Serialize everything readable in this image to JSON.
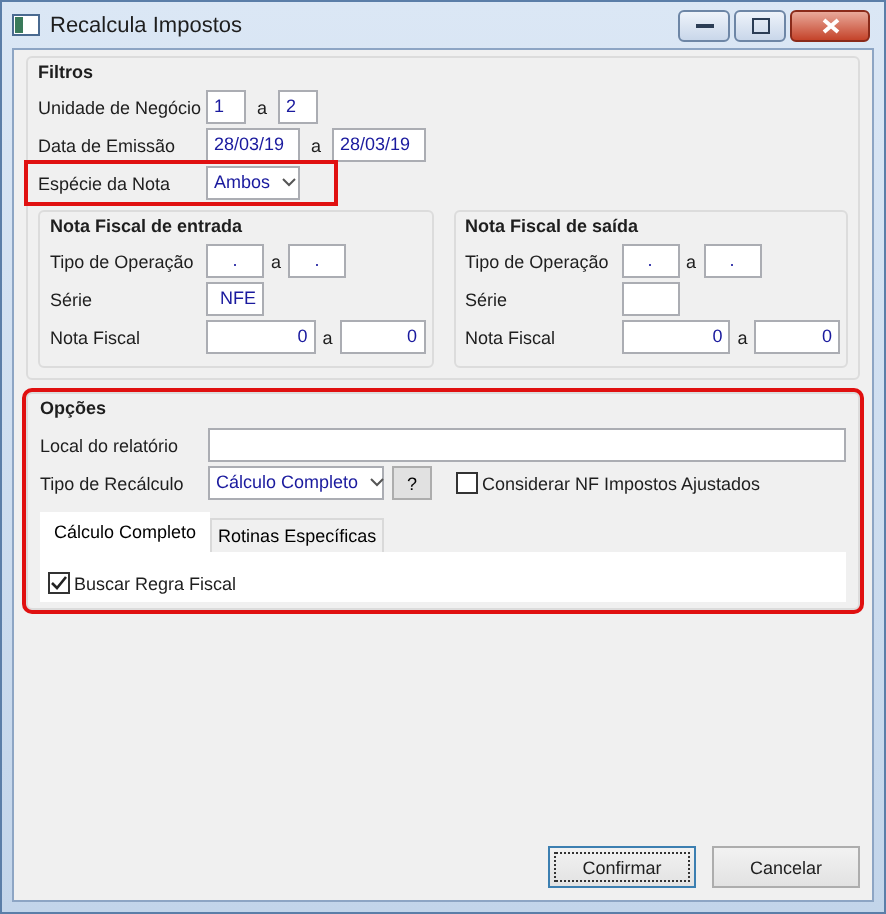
{
  "window": {
    "title": "Recalcula Impostos"
  },
  "filters": {
    "title": "Filtros",
    "business_unit": {
      "label": "Unidade de Negócio",
      "from": "1",
      "separator": "a",
      "to": "2"
    },
    "issue_date": {
      "label": "Data de Emissão",
      "from": "28/03/19",
      "separator": "a",
      "to": "28/03/19"
    },
    "note_type": {
      "label": "Espécie da Nota",
      "value": "Ambos",
      "highlighted": true
    }
  },
  "invoice_groups": [
    {
      "title": "Nota Fiscal de entrada",
      "operation_type": {
        "label": "Tipo de Operação",
        "from": ".",
        "separator": "a",
        "to": "."
      },
      "series": {
        "label": "Série",
        "value": "NFE"
      },
      "invoice_number": {
        "label": "Nota Fiscal",
        "from": "0",
        "separator": "a",
        "to": "0"
      }
    },
    {
      "title": "Nota Fiscal de saída",
      "operation_type": {
        "label": "Tipo de Operação",
        "from": ".",
        "separator": "a",
        "to": "."
      },
      "series": {
        "label": "Série"
      },
      "invoice_number": {
        "label": "Nota Fiscal",
        "from": "0",
        "separator": "a",
        "to": "0"
      }
    }
  ],
  "options": {
    "title": "Opções",
    "highlighted": true,
    "report_location": {
      "label": "Local do relatório"
    },
    "recalc_type": {
      "label": "Tipo de Recálculo",
      "value": "Cálculo Completo",
      "help": "?"
    },
    "adjusted_checkbox": {
      "label": "Considerar NF Impostos Ajustados",
      "checked": false
    },
    "tabs": [
      {
        "label": "Cálculo Completo",
        "selected": true
      },
      {
        "label": "Rotinas Específicas",
        "selected": false
      }
    ],
    "fiscal_rule_checkbox": {
      "label": "Buscar Regra Fiscal",
      "checked": true
    }
  },
  "buttons": [
    {
      "label": "Confirmar",
      "default": true
    },
    {
      "label": "Cancelar",
      "default": false
    }
  ]
}
